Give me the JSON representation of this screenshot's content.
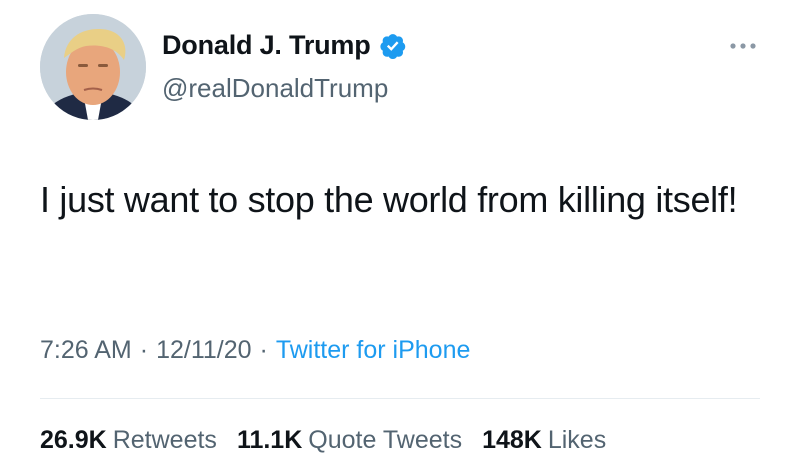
{
  "tweet": {
    "display_name": "Donald J. Trump",
    "handle": "@realDonaldTrump",
    "verified_icon": "verified-badge-icon",
    "more_icon": "more-options-icon",
    "text": "I just want to stop the world from killing itself!",
    "time": "7:26 AM",
    "date": "12/11/20",
    "separator": "·",
    "source": "Twitter for iPhone"
  },
  "stats": [
    {
      "count": "26.9K",
      "label": "Retweets"
    },
    {
      "count": "11.1K",
      "label": "Quote Tweets"
    },
    {
      "count": "148K",
      "label": "Likes"
    }
  ],
  "colors": {
    "text": "#0f1419",
    "secondary": "#536471",
    "link": "#1d9bf0",
    "verified": "#1d9bf0"
  }
}
